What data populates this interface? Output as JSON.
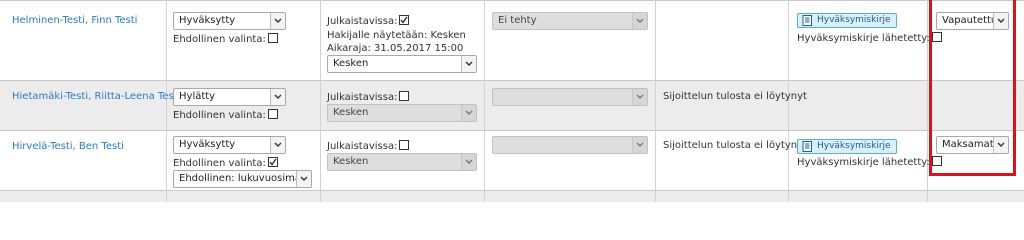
{
  "rows": [
    {
      "name": "Helminen-Testi, Finn Testi",
      "status": "Hyväksytty",
      "conditional_label": "Ehdollinen valinta:",
      "conditional_checked": false,
      "publish_label": "Julkaistavissa:",
      "publish_checked": true,
      "shown_to_applicant": "Hakijalle näytetään: Kesken",
      "deadline": "Aikaraja: 31.05.2017 15:00",
      "state": "Kesken",
      "result": "Ei tehty",
      "placement_text": "",
      "letter_button": "Hyväksymiskirje",
      "letter_sent_label": "Hyväksymiskirje lähetetty:",
      "letter_sent_checked": false,
      "payment": "Vapautettu"
    },
    {
      "name": "Hietamäki-Testi, Riitta-Leena Testi",
      "status": "Hylätty",
      "conditional_label": "Ehdollinen valinta:",
      "conditional_checked": false,
      "publish_label": "Julkaistavissa:",
      "publish_checked": false,
      "state": "Kesken",
      "result": "",
      "placement_text": "Sijoittelun tulosta ei löytynyt"
    },
    {
      "name": "Hirvelä-Testi, Ben Testi",
      "status": "Hyväksytty",
      "conditional_label": "Ehdollinen valinta:",
      "conditional_checked": true,
      "condition_reason": "Ehdollinen: lukuvuosimaksu",
      "publish_label": "Julkaistavissa:",
      "publish_checked": false,
      "state": "Kesken",
      "result": "",
      "placement_text": "Sijoittelun tulosta ei löytynyt",
      "letter_button": "Hyväksymiskirje",
      "letter_sent_label": "Hyväksymiskirje lähetetty:",
      "letter_sent_checked": false,
      "payment": "Maksamatta"
    }
  ],
  "colors": {
    "link": "#2a7bbf",
    "highlight": "#d7141b",
    "button_bg": "#d9effb",
    "row_alt": "#ececec"
  },
  "icons": {
    "checkbox_checked": "checkmark-icon",
    "letter": "document-icon",
    "dropdown": "chevron-down-icon"
  }
}
